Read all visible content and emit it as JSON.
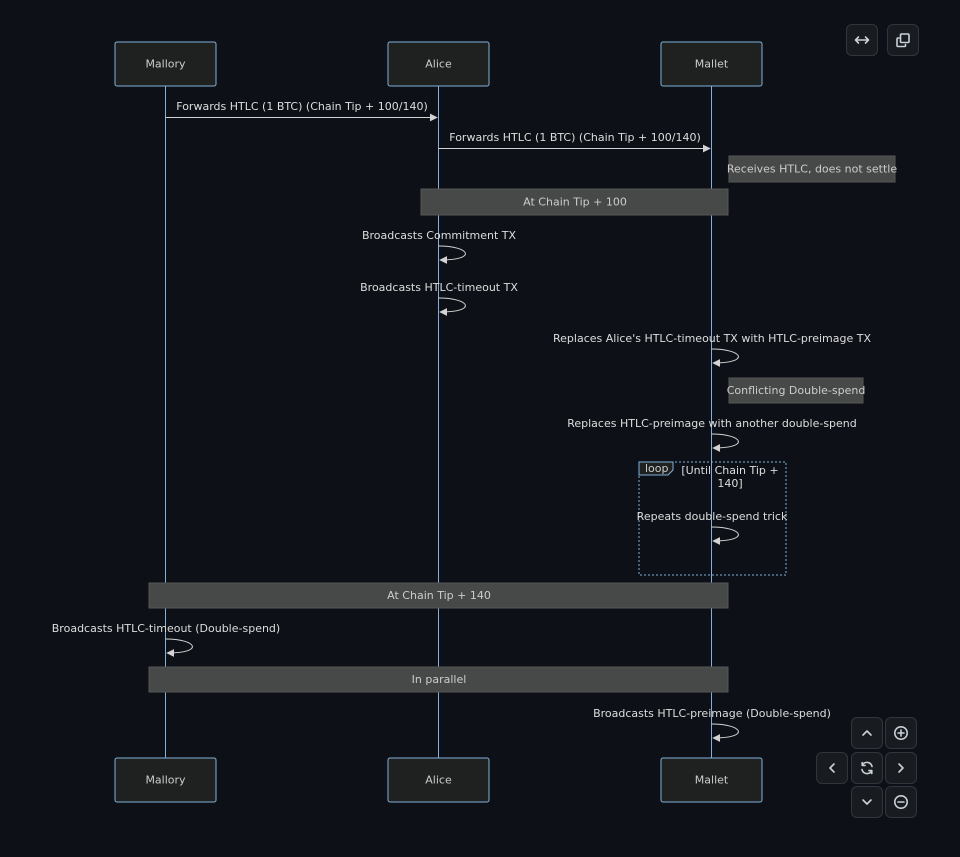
{
  "actors": [
    {
      "id": "mallory",
      "name": "Mallory"
    },
    {
      "id": "alice",
      "name": "Alice"
    },
    {
      "id": "mallet",
      "name": "Mallet"
    }
  ],
  "events": [
    {
      "kind": "message",
      "from": "mallory",
      "to": "alice",
      "text": "Forwards HTLC (1 BTC) (Chain Tip + 100/140)"
    },
    {
      "kind": "message",
      "from": "alice",
      "to": "mallet",
      "text": "Forwards HTLC (1 BTC) (Chain Tip + 100/140)"
    },
    {
      "kind": "note",
      "placement": "right of",
      "actors": [
        "mallet"
      ],
      "text": "Receives HTLC, does not settle"
    },
    {
      "kind": "note",
      "placement": "over",
      "actors": [
        "alice",
        "mallet"
      ],
      "text": "At Chain Tip + 100"
    },
    {
      "kind": "self",
      "actor": "alice",
      "text": "Broadcasts Commitment TX"
    },
    {
      "kind": "self",
      "actor": "alice",
      "text": "Broadcasts HTLC-timeout TX"
    },
    {
      "kind": "self",
      "actor": "mallet",
      "text": "Replaces Alice's HTLC-timeout TX with HTLC-preimage TX"
    },
    {
      "kind": "note",
      "placement": "right of",
      "actors": [
        "mallet"
      ],
      "text": "Conflicting Double-spend"
    },
    {
      "kind": "self",
      "actor": "mallet",
      "text": "Replaces HTLC-preimage with another double-spend"
    },
    {
      "kind": "loop",
      "label": "loop",
      "condition": [
        "[Until Chain Tip +",
        "140]"
      ]
    },
    {
      "kind": "self",
      "actor": "mallet",
      "text": "Repeats double-spend trick"
    },
    {
      "kind": "note",
      "placement": "over",
      "actors": [
        "mallory",
        "mallet"
      ],
      "text": "At Chain Tip + 140"
    },
    {
      "kind": "self",
      "actor": "mallory",
      "text": "Broadcasts HTLC-timeout (Double-spend)"
    },
    {
      "kind": "note",
      "placement": "over",
      "actors": [
        "mallory",
        "mallet"
      ],
      "text": "In parallel"
    },
    {
      "kind": "self",
      "actor": "mallet",
      "text": "Broadcasts HTLC-preimage (Double-spend)"
    }
  ],
  "controls": {
    "top": [
      {
        "id": "fit-width-button",
        "icon": "arrows-horizontal-icon"
      },
      {
        "id": "copy-button",
        "icon": "copy-icon"
      }
    ],
    "nav": [
      {
        "id": "pan-up-button",
        "icon": "chevron-up-icon"
      },
      {
        "id": "zoom-in-button",
        "icon": "zoom-in-icon"
      },
      {
        "id": "pan-left-button",
        "icon": "chevron-left-icon"
      },
      {
        "id": "reset-button",
        "icon": "reset-icon"
      },
      {
        "id": "pan-right-button",
        "icon": "chevron-right-icon"
      },
      {
        "id": "pan-down-button",
        "icon": "chevron-down-icon"
      },
      {
        "id": "zoom-out-button",
        "icon": "zoom-out-icon"
      }
    ]
  },
  "colors": {
    "background": "#0d1117",
    "lifeline": "#81b1db",
    "actor_fill": "#1f2020",
    "note_fill": "#474949",
    "text": "#cccccc"
  }
}
